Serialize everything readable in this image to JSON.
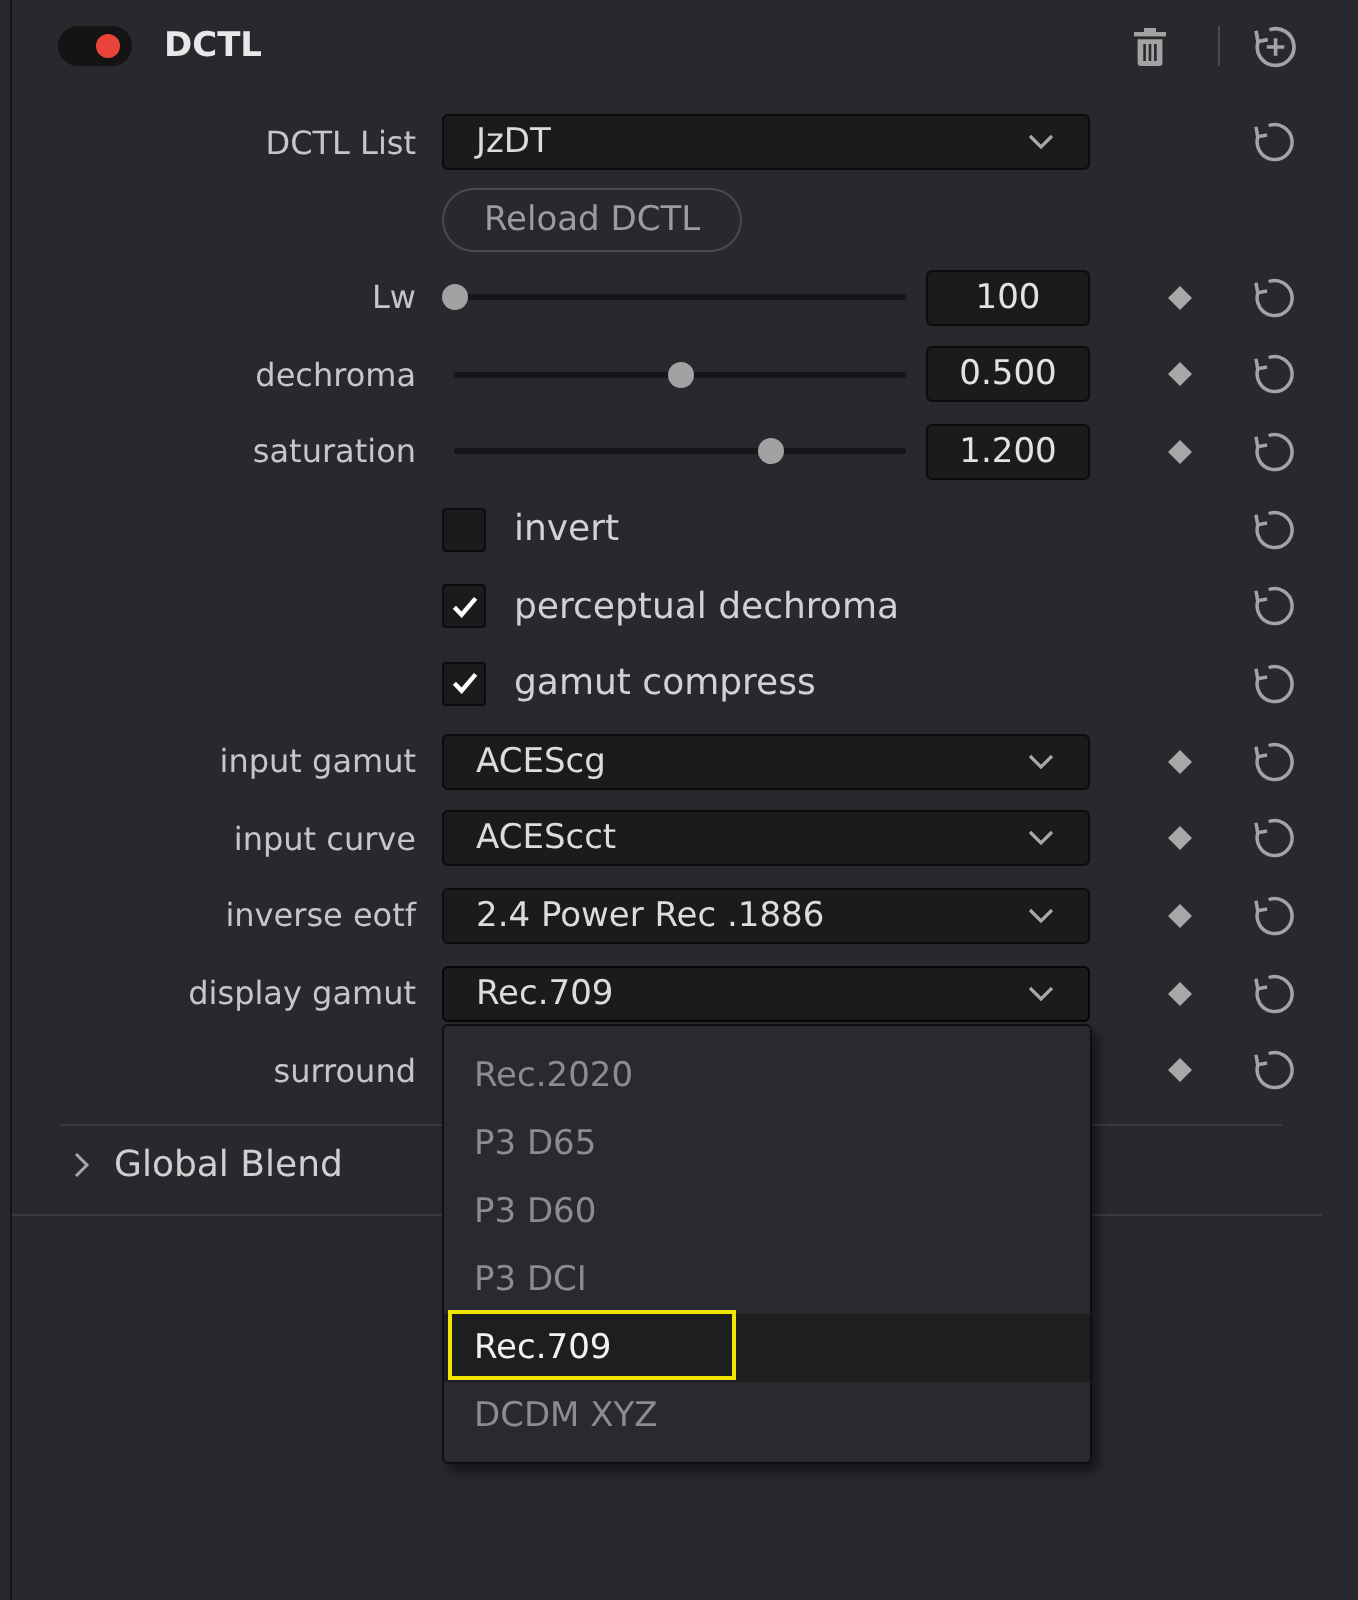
{
  "header": {
    "enabled": true,
    "title": "DCTL"
  },
  "rows": [
    {
      "kind": "dropdown",
      "label": "DCTL List",
      "value": "JzDT",
      "keyframe": false,
      "reset": true
    },
    {
      "kind": "button",
      "label": "Reload DCTL",
      "keyframe": false,
      "reset": false
    },
    {
      "kind": "slider",
      "label": "Lw",
      "value": "100",
      "level": 0,
      "keyframe": true,
      "reset": true
    },
    {
      "kind": "slider",
      "label": "dechroma",
      "value": "0.500",
      "level": 0.5,
      "keyframe": true,
      "reset": true
    },
    {
      "kind": "slider",
      "label": "saturation",
      "value": "1.200",
      "level": 0.7,
      "keyframe": true,
      "reset": true
    },
    {
      "kind": "checkbox",
      "label": "invert",
      "checked": false,
      "keyframe": false,
      "reset": true
    },
    {
      "kind": "checkbox",
      "label": "perceptual dechroma",
      "checked": true,
      "keyframe": false,
      "reset": true
    },
    {
      "kind": "checkbox",
      "label": "gamut compress",
      "checked": true,
      "keyframe": false,
      "reset": true
    },
    {
      "kind": "dropdown",
      "label": "input gamut",
      "value": "ACEScg",
      "keyframe": true,
      "reset": true
    },
    {
      "kind": "dropdown",
      "label": "input curve",
      "value": "ACEScct",
      "keyframe": true,
      "reset": true
    },
    {
      "kind": "dropdown",
      "label": "inverse eotf",
      "value": "2.4 Power Rec .1886",
      "keyframe": true,
      "reset": true
    },
    {
      "kind": "dropdown",
      "label": "display gamut",
      "value": "Rec.709",
      "keyframe": true,
      "reset": true,
      "options": [
        {
          "label": "Rec.2020",
          "selected": false,
          "outlined": false
        },
        {
          "label": "P3 D65",
          "selected": false,
          "outlined": false
        },
        {
          "label": "P3 D60",
          "selected": false,
          "outlined": false
        },
        {
          "label": "P3 DCI",
          "selected": false,
          "outlined": false
        },
        {
          "label": "Rec.709",
          "selected": true,
          "outlined": true
        },
        {
          "label": "DCDM XYZ",
          "selected": false,
          "outlined": false
        }
      ]
    },
    {
      "kind": "dropdown",
      "label": "surround",
      "keyframe": true,
      "reset": true
    }
  ],
  "sections": [
    {
      "label": "Global Blend",
      "expanded": false
    }
  ]
}
